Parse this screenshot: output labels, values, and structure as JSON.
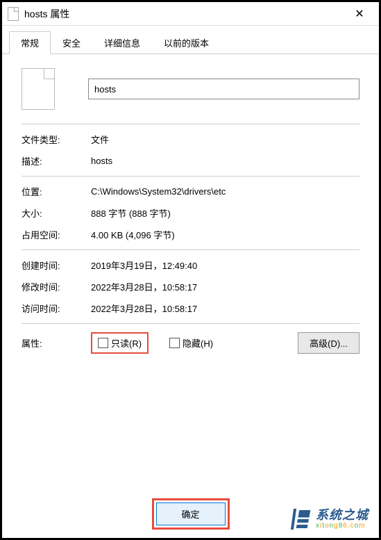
{
  "titlebar": {
    "title": "hosts 属性"
  },
  "tabs": [
    {
      "label": "常规",
      "active": true
    },
    {
      "label": "安全",
      "active": false
    },
    {
      "label": "详细信息",
      "active": false
    },
    {
      "label": "以前的版本",
      "active": false
    }
  ],
  "filename": "hosts",
  "properties": {
    "type_label": "文件类型:",
    "type_value": "文件",
    "desc_label": "描述:",
    "desc_value": "hosts",
    "location_label": "位置:",
    "location_value": "C:\\Windows\\System32\\drivers\\etc",
    "size_label": "大小:",
    "size_value": "888 字节 (888 字节)",
    "disk_label": "占用空间:",
    "disk_value": "4.00 KB (4,096 字节)",
    "created_label": "创建时间:",
    "created_value": "2019年3月19日，12:49:40",
    "modified_label": "修改时间:",
    "modified_value": "2022年3月28日，10:58:17",
    "accessed_label": "访问时间:",
    "accessed_value": "2022年3月28日，10:58:17"
  },
  "attributes": {
    "label": "属性:",
    "readonly_label": "只读(R)",
    "hidden_label": "隐藏(H)",
    "advanced_label": "高级(D)..."
  },
  "buttons": {
    "ok_label": "确定"
  },
  "watermark": {
    "title": "系统之城",
    "url_parts": [
      "x",
      "i",
      "t",
      "o",
      "n",
      "g",
      "8",
      "6",
      ".",
      "c",
      "o",
      "m"
    ]
  }
}
